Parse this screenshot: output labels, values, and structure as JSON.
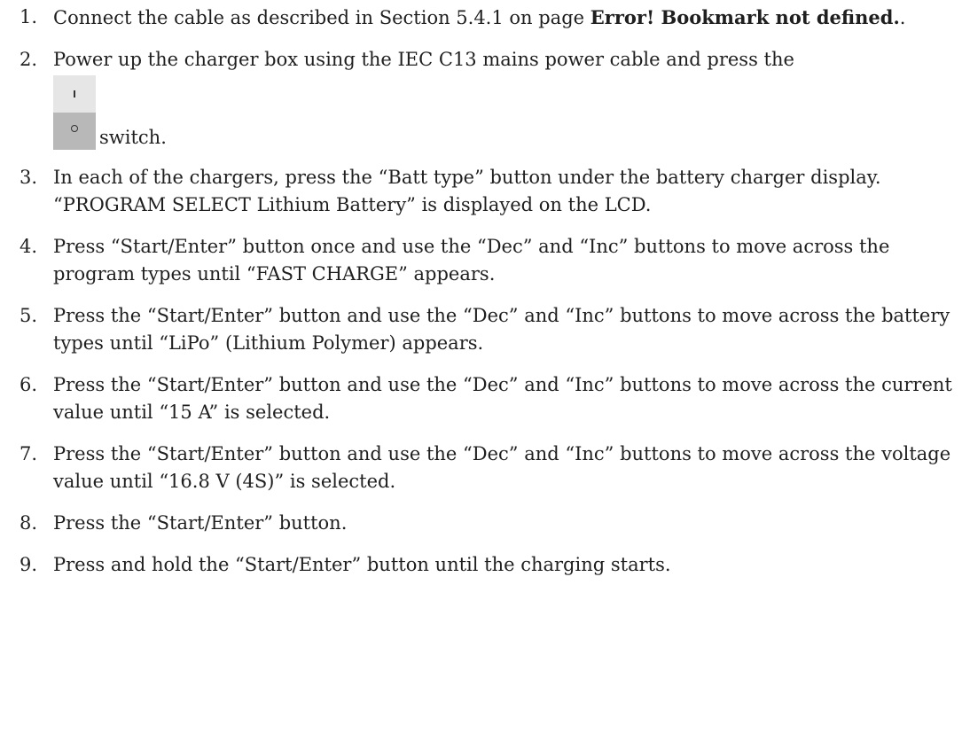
{
  "steps": [
    {
      "num": "1.",
      "pre": "Connect the cable as described in Section 5.4.1 on page ",
      "bold": "Error! Bookmark not defined.",
      "post": "."
    },
    {
      "num": "2.",
      "text": "Power up the charger box using the IEC C13 mains power cable and press the",
      "after_icon": "switch.",
      "icon": "power-rocker-switch"
    },
    {
      "num": "3.",
      "text": "In each of the chargers, press the “Batt type” button under the battery charger display. “PROGRAM SELECT Lithium Battery” is displayed on the LCD."
    },
    {
      "num": "4.",
      "text": "Press “Start/Enter” button once and use the “Dec” and “Inc” buttons to move across the program types until “FAST CHARGE” appears."
    },
    {
      "num": "5.",
      "text": "Press the “Start/Enter” button and use the “Dec” and “Inc” buttons to move across the battery types until “LiPo” (Lithium Polymer) appears."
    },
    {
      "num": "6.",
      "text": "Press the “Start/Enter” button and use the “Dec” and “Inc” buttons to move across the current value until “15 A” is selected."
    },
    {
      "num": "7.",
      "text": "Press the “Start/Enter” button and use the “Dec” and “Inc” buttons to move across the voltage value until “16.8 V (4S)” is selected."
    },
    {
      "num": "8.",
      "text": "Press the “Start/Enter” button."
    },
    {
      "num": "9.",
      "text": "Press and hold the “Start/Enter” button until the charging starts."
    }
  ]
}
